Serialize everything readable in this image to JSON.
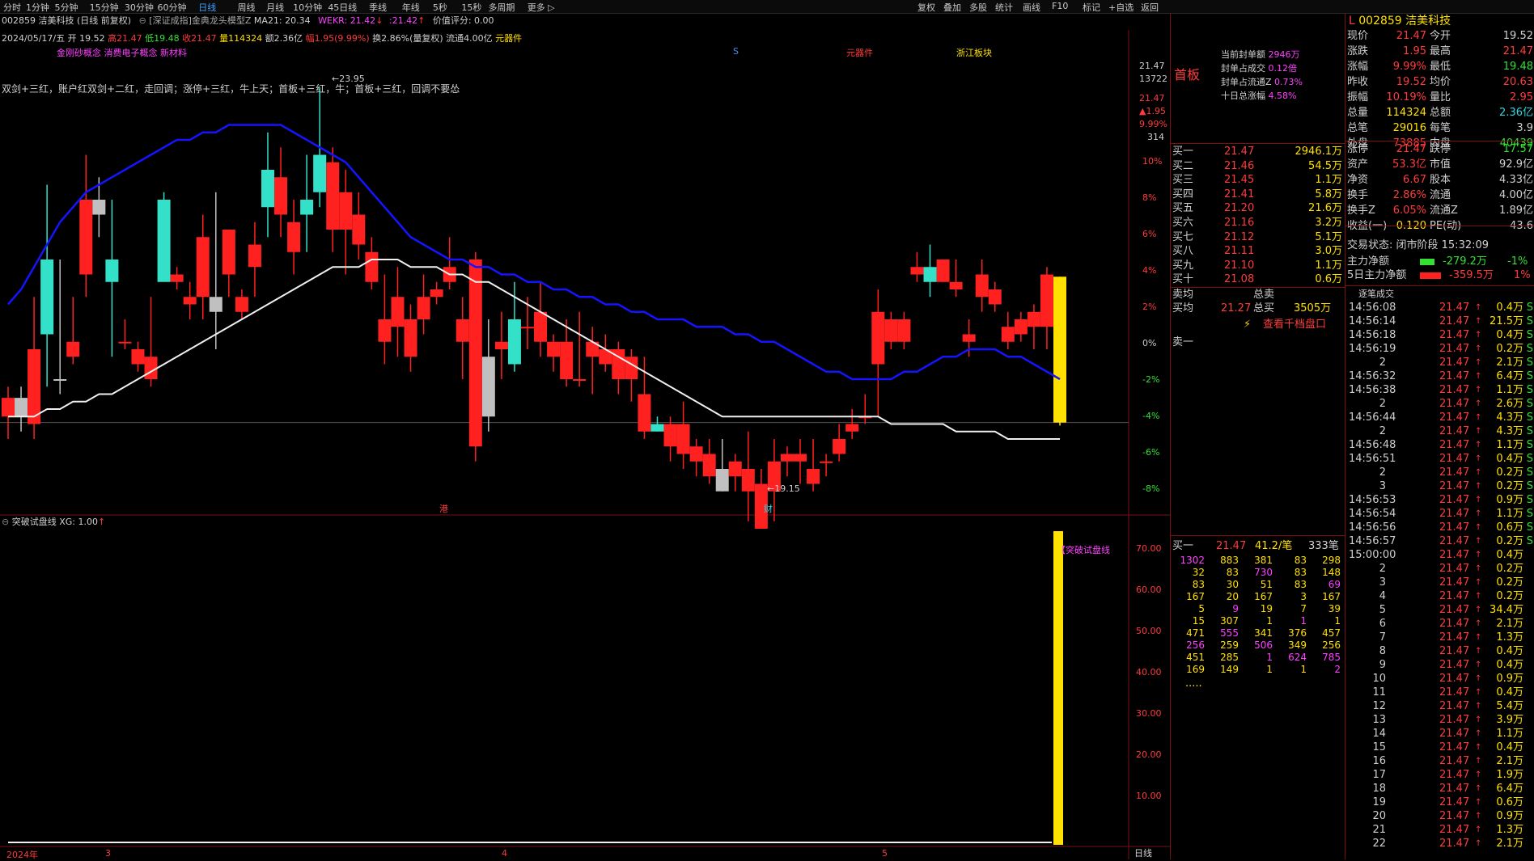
{
  "topbar": {
    "items": [
      "分时",
      "1分钟",
      "5分钟",
      "15分钟",
      "30分钟",
      "60分钟",
      "日线",
      "周线",
      "月线",
      "10分钟",
      "45日线",
      "季线",
      "年线",
      "5秒",
      "15秒",
      "多周期",
      "更多 ▷"
    ],
    "active": "日线",
    "right_items": [
      "复权",
      "叠加",
      "多股",
      "统计",
      "画线",
      "F10",
      "标记",
      "+自选",
      "返回"
    ]
  },
  "chart_header": {
    "stock": "002859 洁美科技 (日线 前复权)",
    "model": "[深证成指]金典龙头模型Z",
    "ma21": "MA21: 20.34",
    "wekr": "WEKR: 21.42",
    "wekr2": "21.42",
    "value_score": "价值评分: 0.00"
  },
  "ohlc_line": {
    "date": "2024/05/17/五",
    "open": "开 19.52",
    "high": "高21.47",
    "low": "低19.48",
    "close": "收21.47",
    "volume": "量114324",
    "amount": "额2.36亿",
    "change": "幅1.95(9.99%)",
    "turnover": "换2.86%(量复权)",
    "float": "流通4.00亿",
    "sector": "元器件"
  },
  "concepts": "金刚砂概念 消费电子概念 新材料",
  "marker_s": "S",
  "marker_yuanqijian": "元器件",
  "marker_zhejiang": "浙江板块",
  "strategy_text": "双剑+三红，账户红双剑+二红，走回调；涨停+三红，牛上天；首板+三红，牛；首板+三红，回调不要怂",
  "high_label": "23.95",
  "low_label": "19.15",
  "event_gang": "港",
  "event_cai": "财",
  "right_scale": {
    "price": "21.47",
    "vol": "13722",
    "p2": "21.47",
    "chg": "▲1.95",
    "pct": "9.99%",
    "n": "314",
    "pct_ticks": [
      "10%",
      "8%",
      "6%",
      "4%",
      "2%",
      "0%",
      "-2%",
      "-4%",
      "-6%",
      "-8%"
    ],
    "sub_ticks": [
      "70.00",
      "60.00",
      "50.00",
      "40.00",
      "30.00",
      "20.00",
      "10.00"
    ],
    "period_label": "日线"
  },
  "indicator": {
    "title": "突破试盘线",
    "xg": "XG: 1.00",
    "tag": "【突破试盘线"
  },
  "x_axis": [
    "2024年",
    "3",
    "4",
    "5"
  ],
  "chart_data": {
    "type": "candlestick",
    "ylim": [
      18.5,
      24.5
    ],
    "candles": [
      [
        19.85,
        19.6,
        20.0,
        19.3,
        "up"
      ],
      [
        19.6,
        19.85,
        20.0,
        19.4,
        "down"
      ],
      [
        20.5,
        19.5,
        21.2,
        19.3,
        "up"
      ],
      [
        21.7,
        20.7,
        22.7,
        20.0,
        "down"
      ],
      [
        20.1,
        20.1,
        21.7,
        19.9,
        "down"
      ],
      [
        20.4,
        20.6,
        21.2,
        20.3,
        "up"
      ],
      [
        22.5,
        21.5,
        23.1,
        21.2,
        "up"
      ],
      [
        22.3,
        22.5,
        22.8,
        22.0,
        "down"
      ],
      [
        21.7,
        21.4,
        22.5,
        20.4,
        "down"
      ],
      [
        20.6,
        20.6,
        20.9,
        20.5,
        "up"
      ],
      [
        20.5,
        20.3,
        20.6,
        20.2,
        "up"
      ],
      [
        20.1,
        20.4,
        21.2,
        20.0,
        "up"
      ],
      [
        22.5,
        21.4,
        22.6,
        21.5,
        "down"
      ],
      [
        21.5,
        21.4,
        21.6,
        21.3,
        "up"
      ],
      [
        21.2,
        21.1,
        21.4,
        20.9,
        "up"
      ],
      [
        22.0,
        21.2,
        22.3,
        20.9,
        "up"
      ],
      [
        21.0,
        21.2,
        22.6,
        20.5,
        "down"
      ],
      [
        22.1,
        21.5,
        22.1,
        21.2,
        "up"
      ],
      [
        21.2,
        21.0,
        21.3,
        20.9,
        "up"
      ],
      [
        21.9,
        21.6,
        22.2,
        21.2,
        "up"
      ],
      [
        22.9,
        22.4,
        23.4,
        22.0,
        "down"
      ],
      [
        22.3,
        22.8,
        23.2,
        22.0,
        "up"
      ],
      [
        22.2,
        21.8,
        22.5,
        21.5,
        "up"
      ],
      [
        22.3,
        22.5,
        23.1,
        21.8,
        "down"
      ],
      [
        23.1,
        22.6,
        24.0,
        22.4,
        "down"
      ],
      [
        23.0,
        22.1,
        23.2,
        21.8,
        "up"
      ],
      [
        22.6,
        22.1,
        22.9,
        21.5,
        "up"
      ],
      [
        22.3,
        21.9,
        22.6,
        21.7,
        "up"
      ],
      [
        21.4,
        21.8,
        22.0,
        21.3,
        "up"
      ],
      [
        20.9,
        20.6,
        21.5,
        20.3,
        "up"
      ],
      [
        21.2,
        20.8,
        21.6,
        20.4,
        "up"
      ],
      [
        20.4,
        20.9,
        21.1,
        20.2,
        "up"
      ],
      [
        20.9,
        21.2,
        21.5,
        20.7,
        "up"
      ],
      [
        21.3,
        21.2,
        21.4,
        21.1,
        "up"
      ],
      [
        21.4,
        21.6,
        22.0,
        21.3,
        "up"
      ],
      [
        20.6,
        20.9,
        21.2,
        20.1,
        "up"
      ],
      [
        19.2,
        21.7,
        21.8,
        19.0,
        "up"
      ],
      [
        19.6,
        20.4,
        20.9,
        19.4,
        "down"
      ],
      [
        20.5,
        20.6,
        21.0,
        20.1,
        "up"
      ],
      [
        20.3,
        20.9,
        21.4,
        20.2,
        "down"
      ],
      [
        20.8,
        20.8,
        21.2,
        20.5,
        "up"
      ],
      [
        21.0,
        20.6,
        21.4,
        20.4,
        "up"
      ],
      [
        20.4,
        20.6,
        20.7,
        20.2,
        "up"
      ],
      [
        20.1,
        20.6,
        20.9,
        20.0,
        "up"
      ],
      [
        20.1,
        20.1,
        21.0,
        20.0,
        "up"
      ],
      [
        20.6,
        20.4,
        20.8,
        19.9,
        "up"
      ],
      [
        20.3,
        20.5,
        20.7,
        20.2,
        "up"
      ],
      [
        20.5,
        20.1,
        20.6,
        19.9,
        "up"
      ],
      [
        20.4,
        20.1,
        20.5,
        19.8,
        "up"
      ],
      [
        19.4,
        19.9,
        20.4,
        19.3,
        "up"
      ],
      [
        19.4,
        19.5,
        19.6,
        19.4,
        "down"
      ],
      [
        19.2,
        19.5,
        19.6,
        19.0,
        "up"
      ],
      [
        19.1,
        19.5,
        19.8,
        18.9,
        "up"
      ],
      [
        19.2,
        19.0,
        19.3,
        18.8,
        "up"
      ],
      [
        19.1,
        18.8,
        19.3,
        18.7,
        "up"
      ],
      [
        18.9,
        18.6,
        19.3,
        18.6,
        "down"
      ],
      [
        18.8,
        19.0,
        19.1,
        18.6,
        "up"
      ],
      [
        18.6,
        18.9,
        19.4,
        18.2,
        "up"
      ],
      [
        18.1,
        18.7,
        18.9,
        18.1,
        "up"
      ],
      [
        19.0,
        18.6,
        19.3,
        18.2,
        "up"
      ],
      [
        19.0,
        19.1,
        19.2,
        18.8,
        "up"
      ],
      [
        19.1,
        19.0,
        19.3,
        18.7,
        "up"
      ],
      [
        18.9,
        18.7,
        19.3,
        18.6,
        "up"
      ],
      [
        19.0,
        19.0,
        19.1,
        18.8,
        "up"
      ],
      [
        19.1,
        19.3,
        19.5,
        19.0,
        "up"
      ],
      [
        19.5,
        19.4,
        19.7,
        19.3,
        "up"
      ],
      [
        19.6,
        19.6,
        19.9,
        19.5,
        "up"
      ],
      [
        21.0,
        20.3,
        21.3,
        19.6,
        "up"
      ],
      [
        20.6,
        20.9,
        21.0,
        20.5,
        "up"
      ],
      [
        20.9,
        20.6,
        21.0,
        20.5,
        "up"
      ],
      [
        21.6,
        21.5,
        21.8,
        21.4,
        "up"
      ],
      [
        21.4,
        21.6,
        21.9,
        21.2,
        "down"
      ],
      [
        21.4,
        21.7,
        21.7,
        21.4,
        "up"
      ],
      [
        21.4,
        21.3,
        21.7,
        21.2,
        "up"
      ],
      [
        20.7,
        20.6,
        20.9,
        20.4,
        "up"
      ],
      [
        21.5,
        21.2,
        21.7,
        21.0,
        "up"
      ],
      [
        21.1,
        21.3,
        21.4,
        21.0,
        "up"
      ],
      [
        20.8,
        20.6,
        21.0,
        20.5,
        "up"
      ],
      [
        20.9,
        20.7,
        21.0,
        20.6,
        "up"
      ],
      [
        21.0,
        20.8,
        21.1,
        20.5,
        "up"
      ],
      [
        21.5,
        20.8,
        21.6,
        20.5,
        "up"
      ],
      [
        21.47,
        19.52,
        21.47,
        19.48,
        "limit"
      ]
    ],
    "blue_ma": [
      21.1,
      21.3,
      21.6,
      21.9,
      22.2,
      22.4,
      22.6,
      22.7,
      22.8,
      22.9,
      23.0,
      23.1,
      23.2,
      23.3,
      23.3,
      23.4,
      23.4,
      23.5,
      23.5,
      23.5,
      23.5,
      23.5,
      23.4,
      23.3,
      23.2,
      23.1,
      23.0,
      22.8,
      22.6,
      22.4,
      22.2,
      22.0,
      21.9,
      21.8,
      21.7,
      21.7,
      21.6,
      21.6,
      21.5,
      21.5,
      21.4,
      21.4,
      21.3,
      21.3,
      21.2,
      21.2,
      21.1,
      21.1,
      21.0,
      21.0,
      20.9,
      20.9,
      20.9,
      20.8,
      20.8,
      20.8,
      20.7,
      20.7,
      20.6,
      20.6,
      20.5,
      20.4,
      20.3,
      20.2,
      20.2,
      20.1,
      20.1,
      20.1,
      20.1,
      20.2,
      20.2,
      20.3,
      20.4,
      20.4,
      20.5,
      20.5,
      20.5,
      20.4,
      20.4,
      20.3,
      20.2,
      20.1
    ],
    "white_ma": [
      19.6,
      19.6,
      19.6,
      19.7,
      19.7,
      19.8,
      19.8,
      19.9,
      19.9,
      20.0,
      20.1,
      20.2,
      20.3,
      20.4,
      20.5,
      20.6,
      20.7,
      20.8,
      20.9,
      21.0,
      21.1,
      21.2,
      21.3,
      21.4,
      21.5,
      21.6,
      21.6,
      21.6,
      21.7,
      21.7,
      21.7,
      21.6,
      21.6,
      21.6,
      21.5,
      21.5,
      21.4,
      21.4,
      21.3,
      21.2,
      21.1,
      21.0,
      20.9,
      20.8,
      20.7,
      20.6,
      20.5,
      20.4,
      20.3,
      20.2,
      20.1,
      20.0,
      19.9,
      19.8,
      19.7,
      19.6,
      19.6,
      19.6,
      19.6,
      19.6,
      19.6,
      19.6,
      19.6,
      19.6,
      19.6,
      19.6,
      19.6,
      19.6,
      19.5,
      19.5,
      19.5,
      19.5,
      19.5,
      19.4,
      19.4,
      19.4,
      19.4,
      19.3,
      19.3,
      19.3,
      19.3,
      19.3
    ]
  },
  "mid_panel": {
    "board_label": "首板",
    "seal_stats": [
      {
        "label": "当前封单额",
        "value": "2946万"
      },
      {
        "label": "封单占成交",
        "value": "0.12倍"
      },
      {
        "label": "封单占流通Z",
        "value": "0.73%"
      },
      {
        "label": "十日总涨幅",
        "value": "4.58%"
      }
    ],
    "bids": [
      {
        "name": "买一",
        "price": "21.47",
        "vol": "2946.1万"
      },
      {
        "name": "买二",
        "price": "21.46",
        "vol": "54.5万"
      },
      {
        "name": "买三",
        "price": "21.45",
        "vol": "1.1万"
      },
      {
        "name": "买四",
        "price": "21.41",
        "vol": "5.8万"
      },
      {
        "name": "买五",
        "price": "21.20",
        "vol": "21.6万"
      },
      {
        "name": "买六",
        "price": "21.16",
        "vol": "3.2万"
      },
      {
        "name": "买七",
        "price": "21.12",
        "vol": "5.1万"
      },
      {
        "name": "买八",
        "price": "21.11",
        "vol": "3.0万"
      },
      {
        "name": "买九",
        "price": "21.10",
        "vol": "1.1万"
      },
      {
        "name": "买十",
        "price": "21.08",
        "vol": "0.6万"
      }
    ],
    "sell_avg": "卖均",
    "total_sell": "总卖",
    "buy_avg": "买均",
    "buy_avg_price": "21.27",
    "total_buy": "总买",
    "total_buy_val": "3505万",
    "view_thousand": "查看千档盘口",
    "sell_one": "卖一",
    "queue_label": "买一",
    "queue_price": "21.47",
    "queue_avg": "41.2/笔",
    "queue_count": "333笔",
    "queue": [
      [
        "1302",
        "883",
        "381",
        "83",
        "298"
      ],
      [
        "32",
        "83",
        "730",
        "83",
        "148"
      ],
      [
        "83",
        "30",
        "51",
        "83",
        "69"
      ],
      [
        "167",
        "20",
        "167",
        "3",
        "167"
      ],
      [
        "5",
        "9",
        "19",
        "7",
        "39"
      ],
      [
        "15",
        "307",
        "1",
        "1",
        "1"
      ],
      [
        "471",
        "555",
        "341",
        "376",
        "457"
      ],
      [
        "256",
        "259",
        "506",
        "349",
        "256"
      ],
      [
        "451",
        "285",
        "1",
        "624",
        "785"
      ],
      [
        "169",
        "149",
        "1",
        "1",
        "2"
      ]
    ],
    "queue_more": "....."
  },
  "quote_panel": {
    "code": "002859",
    "name": "洁美科技",
    "lr": "L",
    "rows": [
      [
        "现价",
        "21.47",
        "今开",
        "19.52"
      ],
      [
        "涨跌",
        "1.95",
        "最高",
        "21.47"
      ],
      [
        "涨幅",
        "9.99%",
        "最低",
        "19.48"
      ],
      [
        "昨收",
        "19.52",
        "均价",
        "20.63"
      ],
      [
        "振幅",
        "10.19%",
        "量比",
        "2.95"
      ],
      [
        "总量",
        "114324",
        "总额",
        "2.36亿"
      ],
      [
        "总笔",
        "29016",
        "每笔",
        "3.9"
      ],
      [
        "外盘",
        "73885",
        "内盘",
        "40439"
      ]
    ],
    "rows2": [
      [
        "涨停",
        "21.47",
        "跌停",
        "17.57"
      ],
      [
        "资产",
        "53.3亿",
        "市值",
        "92.9亿"
      ],
      [
        "净资",
        "6.67",
        "股本",
        "4.33亿"
      ],
      [
        "换手",
        "2.86%",
        "流通",
        "4.00亿"
      ],
      [
        "换手Z",
        "6.05%",
        "流通Z",
        "1.89亿"
      ],
      [
        "收益(一)",
        "0.120",
        "PE(动)",
        "43.6"
      ]
    ],
    "trade_status": "交易状态: 闭市阶段 15:32:09",
    "main_flow_label": "主力净额",
    "main_flow": "-279.2万",
    "main_flow_pct": "-1%",
    "flow5_label": "5日主力净额",
    "flow5": "-359.5万",
    "flow5_pct": "1%",
    "ticks_title": "逐笔成交",
    "ticks": [
      [
        "14:56:08",
        "21.47",
        "0.4万",
        "S"
      ],
      [
        "14:56:14",
        "21.47",
        "21.5万",
        "S"
      ],
      [
        "14:56:18",
        "21.47",
        "0.4万",
        "S"
      ],
      [
        "14:56:19",
        "21.47",
        "0.2万",
        "S"
      ],
      [
        "2",
        "21.47",
        "2.1万",
        "S"
      ],
      [
        "14:56:32",
        "21.47",
        "6.4万",
        "S"
      ],
      [
        "14:56:38",
        "21.47",
        "1.1万",
        "S"
      ],
      [
        "2",
        "21.47",
        "2.6万",
        "S"
      ],
      [
        "14:56:44",
        "21.47",
        "4.3万",
        "S"
      ],
      [
        "2",
        "21.47",
        "4.3万",
        "S"
      ],
      [
        "14:56:48",
        "21.47",
        "1.1万",
        "S"
      ],
      [
        "14:56:51",
        "21.47",
        "0.4万",
        "S"
      ],
      [
        "2",
        "21.47",
        "0.2万",
        "S"
      ],
      [
        "3",
        "21.47",
        "0.2万",
        "S"
      ],
      [
        "14:56:53",
        "21.47",
        "0.9万",
        "S"
      ],
      [
        "14:56:54",
        "21.47",
        "1.1万",
        "S"
      ],
      [
        "14:56:56",
        "21.47",
        "0.6万",
        "S"
      ],
      [
        "14:56:57",
        "21.47",
        "0.2万",
        "S"
      ],
      [
        "15:00:00",
        "21.47",
        "0.4万",
        ""
      ],
      [
        "2",
        "21.47",
        "0.2万",
        ""
      ],
      [
        "3",
        "21.47",
        "0.2万",
        ""
      ],
      [
        "4",
        "21.47",
        "0.2万",
        ""
      ],
      [
        "5",
        "21.47",
        "34.4万",
        ""
      ],
      [
        "6",
        "21.47",
        "2.1万",
        ""
      ],
      [
        "7",
        "21.47",
        "1.3万",
        ""
      ],
      [
        "8",
        "21.47",
        "0.4万",
        ""
      ],
      [
        "9",
        "21.47",
        "0.4万",
        ""
      ],
      [
        "10",
        "21.47",
        "0.9万",
        ""
      ],
      [
        "11",
        "21.47",
        "0.4万",
        ""
      ],
      [
        "12",
        "21.47",
        "5.4万",
        ""
      ],
      [
        "13",
        "21.47",
        "3.9万",
        ""
      ],
      [
        "14",
        "21.47",
        "1.1万",
        ""
      ],
      [
        "15",
        "21.47",
        "0.4万",
        ""
      ],
      [
        "16",
        "21.47",
        "2.1万",
        ""
      ],
      [
        "17",
        "21.47",
        "1.9万",
        ""
      ],
      [
        "18",
        "21.47",
        "6.4万",
        ""
      ],
      [
        "19",
        "21.47",
        "0.6万",
        ""
      ],
      [
        "20",
        "21.47",
        "0.9万",
        ""
      ],
      [
        "21",
        "21.47",
        "1.3万",
        ""
      ],
      [
        "22",
        "21.47",
        "2.1万",
        ""
      ]
    ]
  },
  "colors": {
    "up": "#ff2020",
    "down": "#33e0c8",
    "flat": "#c0c0c0",
    "limit": "#ffe000",
    "blue": "#1414ff",
    "white": "#f0f0f0",
    "frame": "#7a1010"
  }
}
